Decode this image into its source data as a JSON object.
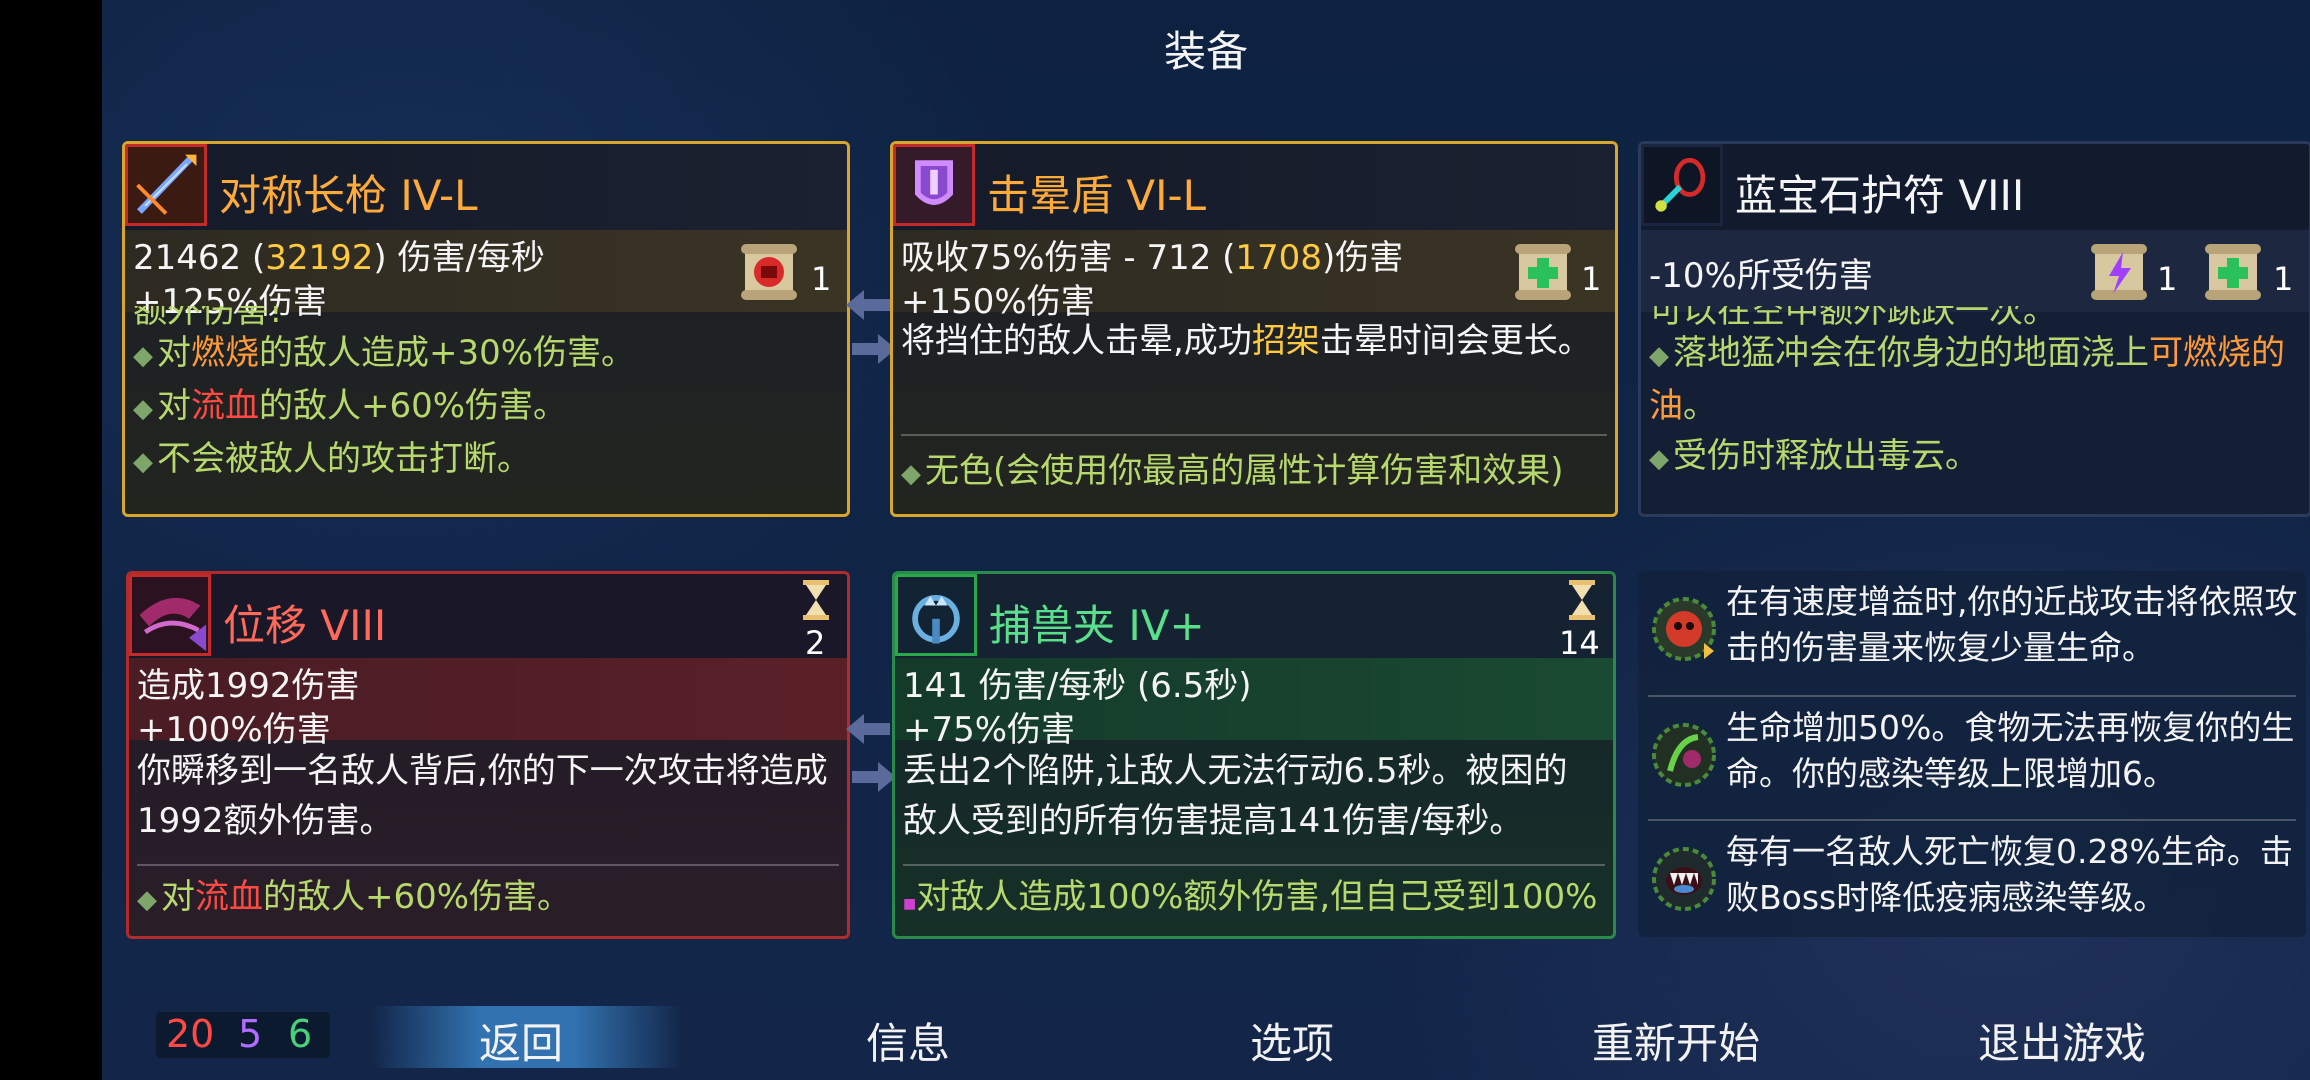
{
  "title": "装备",
  "cards": {
    "spear": {
      "name": "对称长枪  IV-L",
      "stat1_a": "21462 (",
      "stat1_b": "32192",
      "stat1_c": ") 伤害/每秒",
      "stat2": "+125%伤害",
      "scroll_count": "1",
      "cut_text": "额外伤害!",
      "l1_a": "对",
      "l1_b": "燃烧",
      "l1_c": "的敌人造成+30%伤害。",
      "l2_a": "对",
      "l2_b": "流血",
      "l2_c": "的敌人+60%伤害。",
      "l3": "不会被敌人的攻击打断。"
    },
    "shield": {
      "name": "击晕盾  VI-L",
      "stat1_a": "吸收75%伤害 - 712 (",
      "stat1_b": "1708",
      "stat1_c": ")伤害",
      "stat2": "+150%伤害",
      "scroll_count": "1",
      "d1_a": "将挡住的敌人击晕,成功",
      "d1_b": "招架",
      "d1_c": "击晕时间会更长。",
      "l1": "无色(会使用你最高的属性计算伤害和效果)"
    },
    "amulet": {
      "name": "蓝宝石护符  VIII",
      "stat1": "-10%所受伤害",
      "scroll1_count": "1",
      "scroll2_count": "1",
      "cut_text": "可以在空中额外跳跃一次。",
      "l1_a": "落地猛冲会在你身边的地面浇上",
      "l1_b": "可燃烧的油",
      "l1_c": "。",
      "l2": "受伤时释放出毒云。"
    },
    "blink": {
      "name": "位移  VIII",
      "cooldown": "2",
      "stat1": "造成1992伤害",
      "stat2": "+100%伤害",
      "d1": "你瞬移到一名敌人背后,你的下一次攻击将造成1992额外伤害。",
      "l1_a": "对",
      "l1_b": "流血",
      "l1_c": "的敌人+60%伤害。"
    },
    "trap": {
      "name": "捕兽夹  IV+",
      "cooldown": "14",
      "stat1": "141 伤害/每秒 (6.5秒)",
      "stat2": "+75%伤害",
      "d1": "丢出2个陷阱,让敌人无法行动6.5秒。被困的敌人受到的所有伤害提高141伤害/每秒。",
      "l1": "对敌人造成100%额外伤害,但自己受到100%"
    }
  },
  "perks": [
    {
      "icon": "red-skull-perk-icon",
      "text": "在有速度增益时,你的近战攻击将依照攻击的伤害量来恢复少量生命。"
    },
    {
      "icon": "green-plant-perk-icon",
      "text": "生命增加50%。食物无法再恢复你的生命。你的感染等级上限增加6。"
    },
    {
      "icon": "fanged-mouth-perk-icon",
      "text": "每有一名敌人死亡恢复0.28%生命。击败Boss时降低疫病感染等级。"
    }
  ],
  "resources": {
    "red": "20",
    "purple": "5",
    "green": "6"
  },
  "menu": {
    "back": "返回",
    "info": "信息",
    "options": "选项",
    "restart": "重新开始",
    "quit": "退出游戏"
  },
  "colors": {
    "gold": "#d9a62c",
    "red_card": "#b22a2a",
    "green_card": "#2a8a4a",
    "brutality": "#ff4a44",
    "tactics": "#b06cff",
    "survival": "#49d17a"
  }
}
